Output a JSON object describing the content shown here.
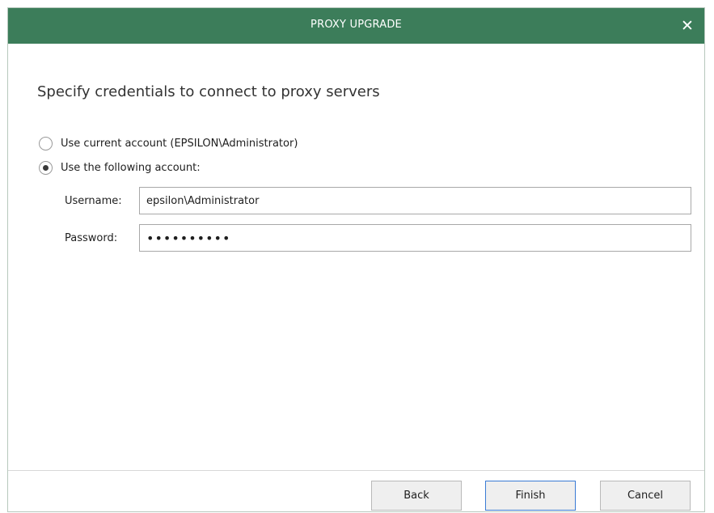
{
  "dialog": {
    "title": "PROXY UPGRADE",
    "close_icon": "close-icon"
  },
  "heading": "Specify credentials to connect to proxy servers",
  "credentials": {
    "option_current": "Use current account (EPSILON\\Administrator)",
    "option_following": "Use the following account:",
    "selected": "following",
    "username_label": "Username:",
    "username_value": "epsilon\\Administrator",
    "password_label": "Password:",
    "password_value": "••••••••••"
  },
  "buttons": {
    "back": "Back",
    "finish": "Finish",
    "cancel": "Cancel"
  },
  "colors": {
    "titlebar": "#3c7d5a",
    "primary_focus": "#3a7bd5"
  }
}
